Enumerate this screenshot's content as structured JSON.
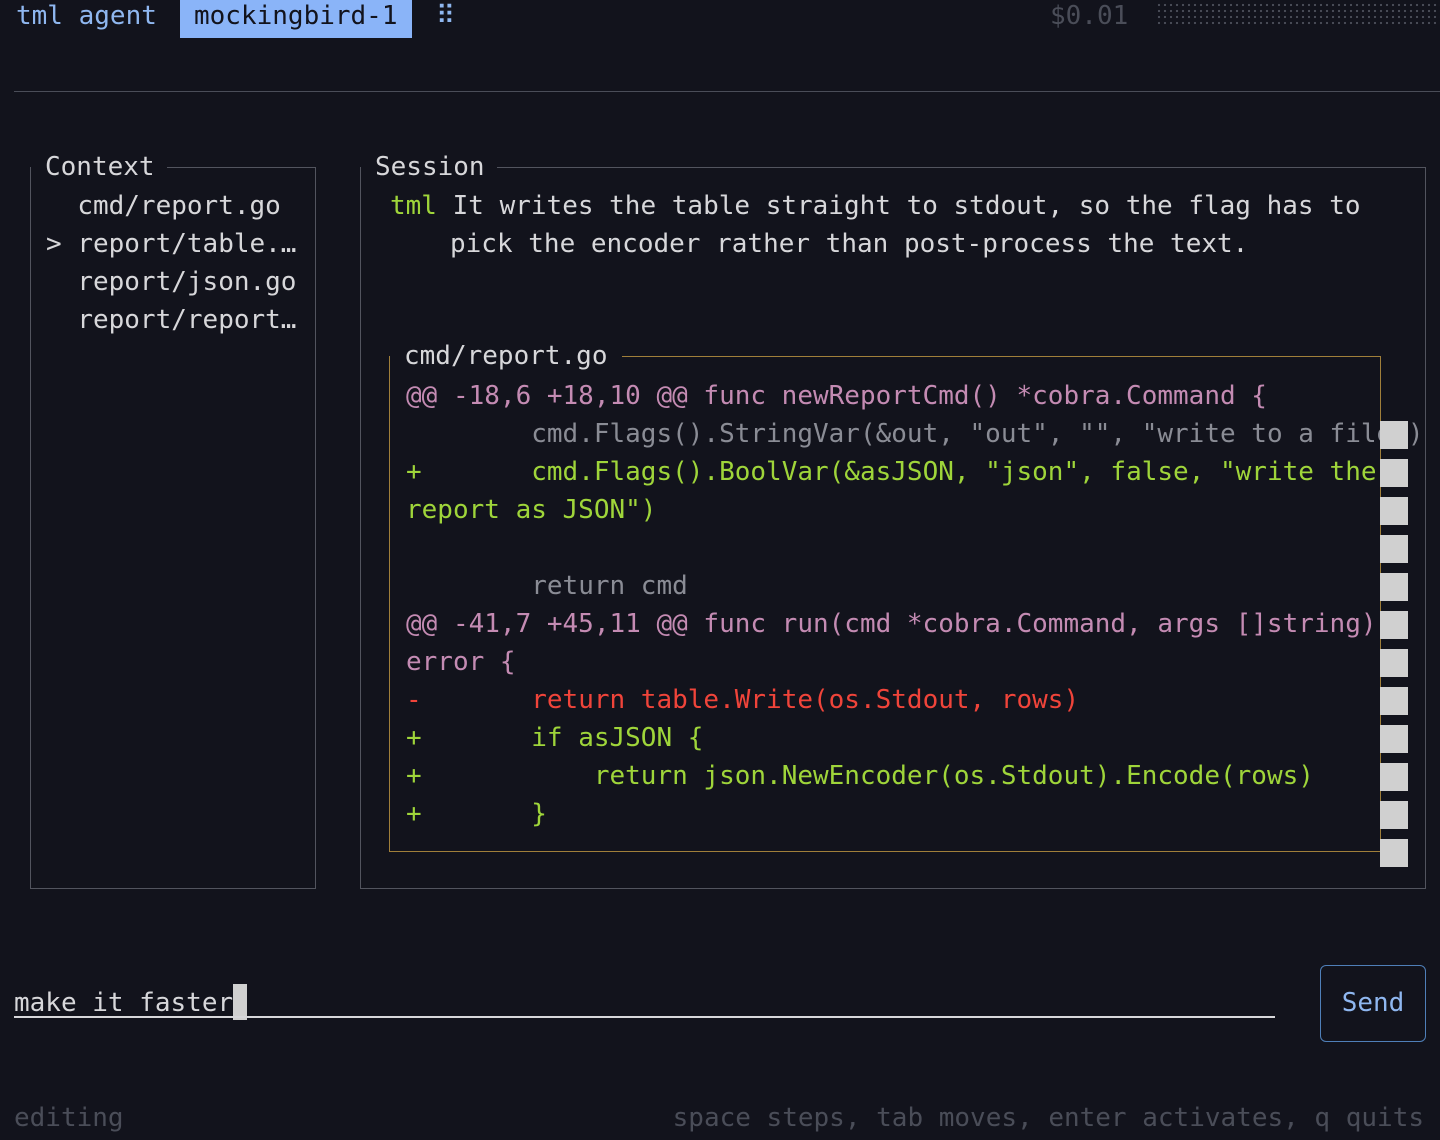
{
  "header": {
    "app_name": "tml agent",
    "active_tab": "mockingbird-1",
    "menu_glyph": "⠿",
    "cost": "$0.01"
  },
  "context": {
    "title": "Context",
    "items": [
      {
        "label": "cmd/report.go",
        "marker": " "
      },
      {
        "label": "report/table.…",
        "marker": ">"
      },
      {
        "label": "report/json.go",
        "marker": " "
      },
      {
        "label": "report/report…",
        "marker": " "
      }
    ]
  },
  "session": {
    "title": "Session",
    "message": {
      "speaker": "tml",
      "line1": "It writes the table straight to stdout, so the flag has to",
      "line2": "pick the encoder rather than post-process the text."
    },
    "diff": {
      "file": "cmd/report.go",
      "lines": [
        {
          "kind": "hunk",
          "text": "@@ -18,6 +18,10 @@ func newReportCmd() *cobra.Command {"
        },
        {
          "kind": "ctx",
          "prefix": " ",
          "text": "    cmd.Flags().StringVar(&out, \"out\", \"\", \"write to a file\")"
        },
        {
          "kind": "add",
          "prefix": "+",
          "text": "    cmd.Flags().BoolVar(&asJSON, \"json\", false, \"write the"
        },
        {
          "kind": "add-cont",
          "text": "report as JSON\")"
        },
        {
          "kind": "ctx",
          "prefix": " ",
          "text": ""
        },
        {
          "kind": "ctx",
          "prefix": " ",
          "text": "    return cmd"
        },
        {
          "kind": "hunk",
          "text": "@@ -41,7 +45,11 @@ func run(cmd *cobra.Command, args []string)"
        },
        {
          "kind": "hunk-cont",
          "text": "error {"
        },
        {
          "kind": "del",
          "prefix": "-",
          "text": "    return table.Write(os.Stdout, rows)"
        },
        {
          "kind": "add",
          "prefix": "+",
          "text": "    if asJSON {"
        },
        {
          "kind": "add",
          "prefix": "+",
          "text": "        return json.NewEncoder(os.Stdout).Encode(rows)"
        },
        {
          "kind": "add",
          "prefix": "+",
          "text": "    }"
        }
      ]
    }
  },
  "composer": {
    "input_value": "make it faster",
    "send_label": "Send"
  },
  "status": {
    "mode": "editing",
    "hints": "space steps, tab moves, enter activates, q quits"
  },
  "colors": {
    "background": "#12131c",
    "accent": "#8ab4f8",
    "added": "#9fd53a",
    "removed": "#f0443a",
    "hunk": "#c48bb3",
    "diff_border": "#a07f3a"
  }
}
